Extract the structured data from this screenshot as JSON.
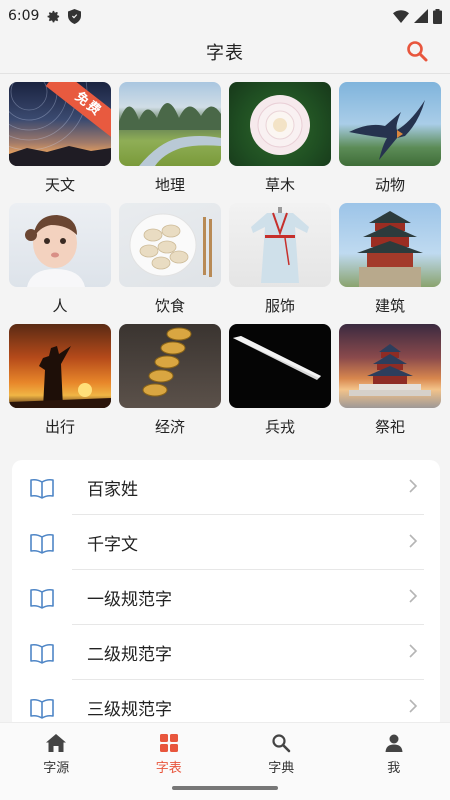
{
  "status_bar": {
    "time": "6:09"
  },
  "header": {
    "title": "字表"
  },
  "colors": {
    "accent": "#e8563d",
    "icon_blue": "#4f86c6"
  },
  "categories": [
    {
      "label": "天文",
      "icon": "night-sky-photo",
      "badge": "免费"
    },
    {
      "label": "地理",
      "icon": "karst-river-photo"
    },
    {
      "label": "草木",
      "icon": "dahlia-photo"
    },
    {
      "label": "动物",
      "icon": "swallow-photo"
    },
    {
      "label": "人",
      "icon": "baby-photo"
    },
    {
      "label": "饮食",
      "icon": "dumplings-photo"
    },
    {
      "label": "服饰",
      "icon": "hanfu-photo"
    },
    {
      "label": "建筑",
      "icon": "pavilion-photo"
    },
    {
      "label": "出行",
      "icon": "sunset-rider-photo"
    },
    {
      "label": "经济",
      "icon": "coins-photo"
    },
    {
      "label": "兵戎",
      "icon": "sword-photo"
    },
    {
      "label": "祭祀",
      "icon": "temple-of-heaven-photo"
    }
  ],
  "book_list": [
    {
      "label": "百家姓"
    },
    {
      "label": "千字文"
    },
    {
      "label": "一级规范字"
    },
    {
      "label": "二级规范字"
    },
    {
      "label": "三级规范字"
    }
  ],
  "bottom_nav": [
    {
      "label": "字源",
      "icon": "home-icon"
    },
    {
      "label": "字表",
      "icon": "grid-icon",
      "active": true
    },
    {
      "label": "字典",
      "icon": "search-icon"
    },
    {
      "label": "我",
      "icon": "person-icon"
    }
  ]
}
